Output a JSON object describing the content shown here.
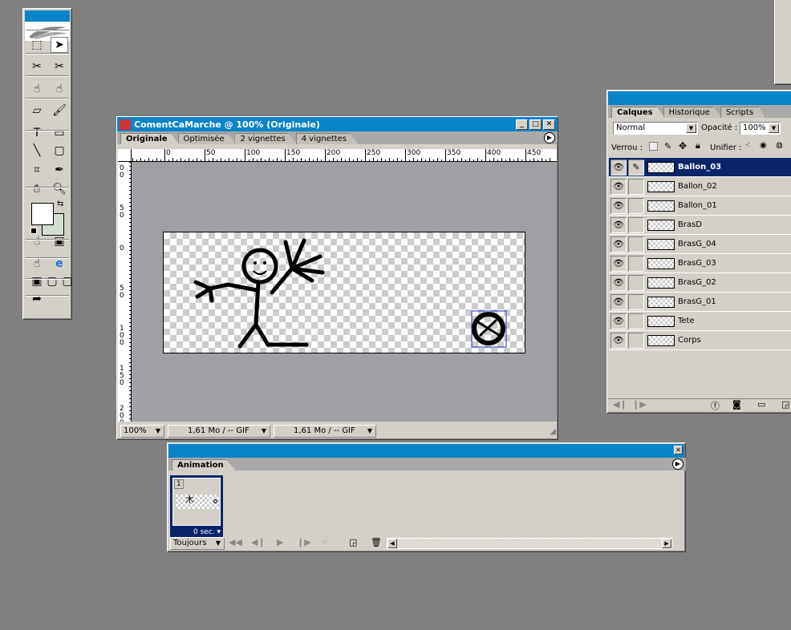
{
  "toolbox": {
    "tools": [
      "marquee",
      "select-move",
      "slice",
      "slice-select",
      "image-map",
      "image-map-select",
      "eraser",
      "brush",
      "type",
      "rectangle",
      "line",
      "rounded-rectangle",
      "crop",
      "eyedropper",
      "hand",
      "zoom",
      "toggle-image-map",
      "toggle-slices",
      "preview",
      "preview-browser",
      "screen-mode-standard",
      "screen-mode-full-menu",
      "screen-mode-full",
      "jump-to-photoshop"
    ],
    "foreground_color": "#ffffff",
    "background_color": "#d2e0d0"
  },
  "document": {
    "title": "ComentCaMarche @ 100% (Originale)",
    "tabs": [
      {
        "label": "Originale",
        "active": true
      },
      {
        "label": "Optimisée"
      },
      {
        "label": "2 vignettes"
      },
      {
        "label": "4 vignettes"
      }
    ],
    "ruler_h": [
      "0",
      "50",
      "100",
      "150",
      "200",
      "250",
      "300",
      "350",
      "400",
      "450"
    ],
    "ruler_v": [
      "00",
      "50",
      "0",
      "50",
      "100",
      "150",
      "200"
    ],
    "status": {
      "zoom": "100%",
      "info1": "1,61 Mo / -- GIF",
      "info2": "1,61 Mo / -- GIF"
    }
  },
  "layers_panel": {
    "tabs": [
      {
        "label": "Calques",
        "active": true
      },
      {
        "label": "Historique"
      },
      {
        "label": "Scripts"
      }
    ],
    "blend_mode": "Normal",
    "opacity_label": "Opacité :",
    "opacity": "100%",
    "lock_label": "Verrou :",
    "unify_label": "Unifier :",
    "layers": [
      {
        "name": "Ballon_03",
        "selected": true
      },
      {
        "name": "Ballon_02"
      },
      {
        "name": "Ballon_01"
      },
      {
        "name": "BrasD"
      },
      {
        "name": "BrasG_04"
      },
      {
        "name": "BrasG_03"
      },
      {
        "name": "BrasG_02"
      },
      {
        "name": "BrasG_01"
      },
      {
        "name": "Tete"
      },
      {
        "name": "Corps"
      }
    ]
  },
  "animation_panel": {
    "tab": "Animation",
    "frames": [
      {
        "number": "1",
        "delay": "0 sec."
      }
    ],
    "loop": "Toujours"
  },
  "colors": {
    "titlebar": "#0a84c8",
    "selection": "#0a246a",
    "panel": "#d4d0c8",
    "desktop": "#808080"
  }
}
